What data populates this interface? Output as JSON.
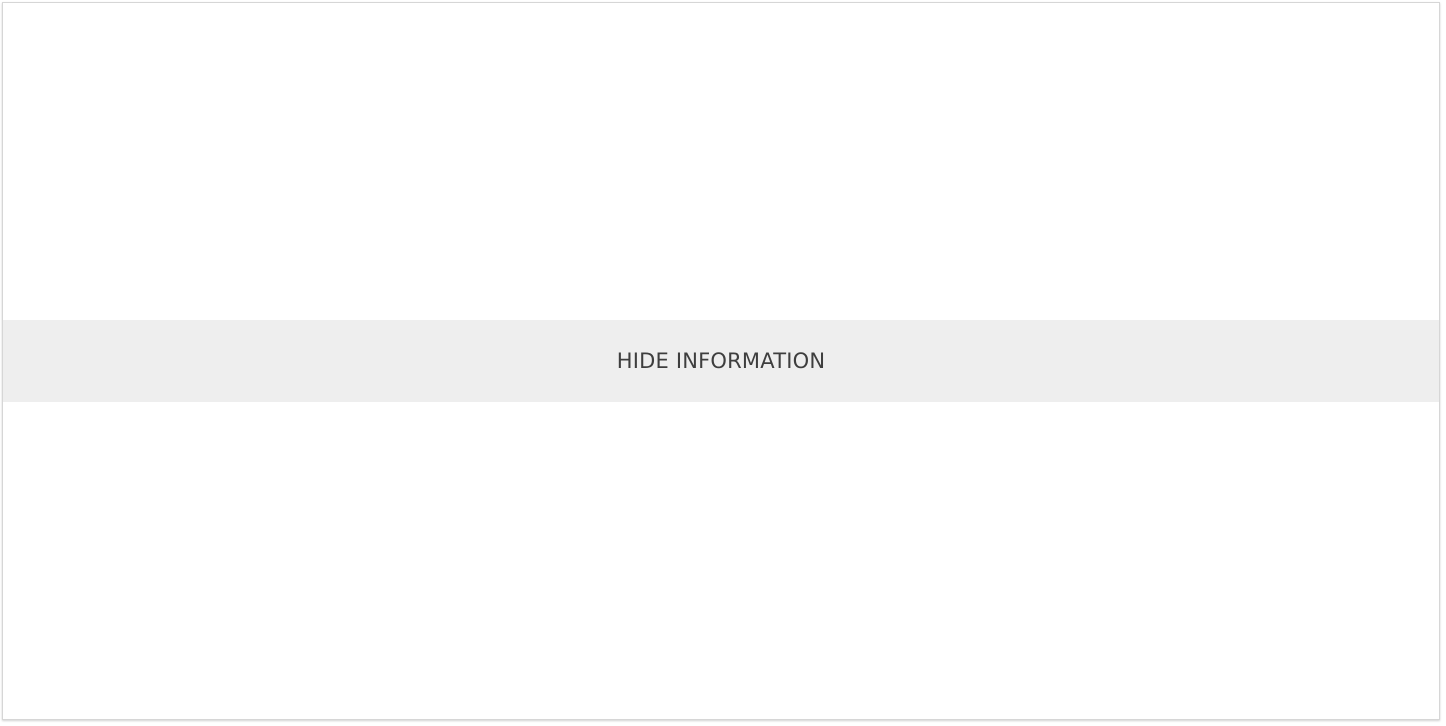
{
  "panel": {
    "toggle": {
      "label": "HIDE INFORMATION"
    }
  },
  "colors": {
    "background": "#ffffff",
    "bar": "#eeeeee",
    "text": "#3e3e3e",
    "border": "#d6d6d6"
  }
}
